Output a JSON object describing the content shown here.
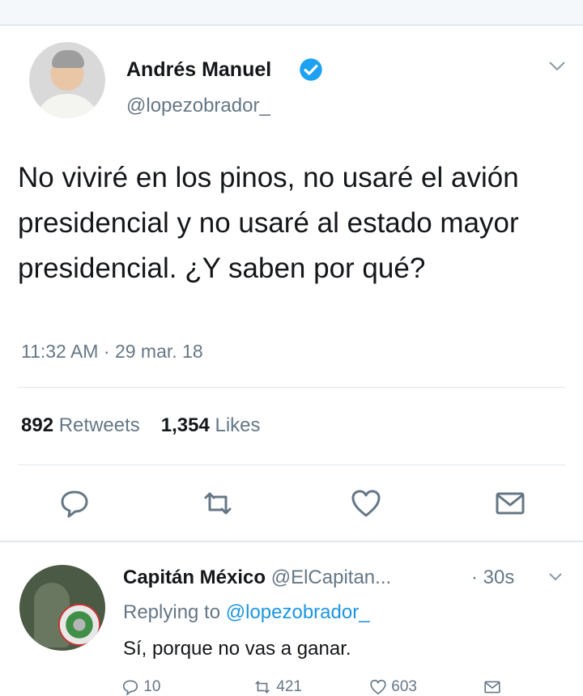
{
  "tweet": {
    "author_name": "Andrés Manuel",
    "handle": "@lopezobrador_",
    "text": "No viviré en los pinos, no usaré el avión presidencial y no usaré al estado mayor presidencial. ¿Y saben por qué?",
    "time": "11:32 AM",
    "date": "29 mar. 18",
    "retweets_count": "892",
    "retweets_label": "Retweets",
    "likes_count": "1,354",
    "likes_label": "Likes"
  },
  "reply": {
    "author_name": "Capitán México",
    "handle": "@ElCapitan...",
    "time": "· 30s",
    "replying_prefix": "Replying to",
    "replying_to": "@lopezobrador_",
    "text": "Sí, porque no vas a ganar.",
    "reply_count": "10",
    "retweet_count": "421",
    "like_count": "603"
  },
  "icons": {
    "verified": "verified-badge-icon",
    "reply": "reply-icon",
    "retweet": "retweet-icon",
    "like": "heart-icon",
    "dm": "envelope-icon",
    "menu": "chevron-down-icon"
  },
  "colors": {
    "text": "#14171a",
    "muted": "#657786",
    "link": "#1b95e0",
    "verified": "#1da1f2",
    "divider": "#e1e8ed"
  }
}
